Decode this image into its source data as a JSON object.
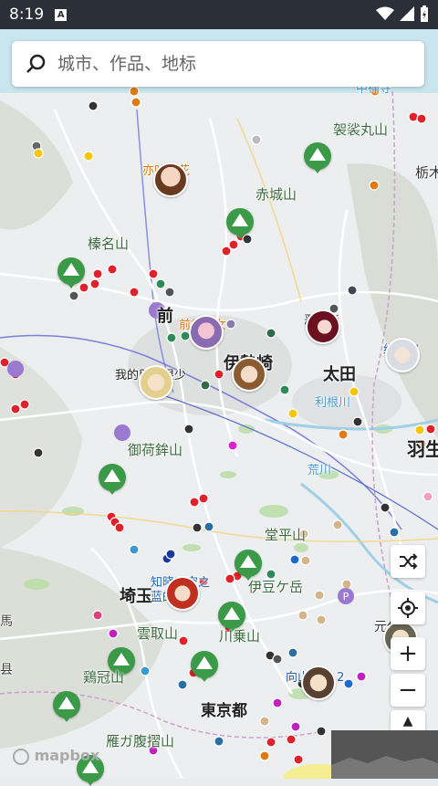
{
  "status_bar": {
    "time": "8:19",
    "notification_glyph": "A"
  },
  "search": {
    "placeholder": "城市、作品、地标"
  },
  "mountains": [
    {
      "name": "袈裟丸山"
    },
    {
      "name": "赤城山"
    },
    {
      "name": "榛名山"
    },
    {
      "name": "御荷鉾山"
    },
    {
      "name": "堂平山"
    },
    {
      "name": "伊豆ケ岳"
    },
    {
      "name": "雲取山"
    },
    {
      "name": "川乗山"
    },
    {
      "name": "鶏冠山"
    },
    {
      "name": "雁ガ腹摺山"
    }
  ],
  "cities": [
    {
      "name": "前"
    },
    {
      "name": "伊勢崎"
    },
    {
      "name": "太田"
    },
    {
      "name": "羽生"
    },
    {
      "name": "荒川"
    },
    {
      "name": "利根川"
    },
    {
      "name": "埼玉"
    },
    {
      "name": "東京都"
    },
    {
      "name": "中禅寺"
    },
    {
      "name": "栃木"
    },
    {
      "name": "元代"
    },
    {
      "name": "县"
    },
    {
      "name": "馬"
    }
  ],
  "works": [
    {
      "name": "亦叶亦花"
    },
    {
      "name": "前桥魔女"
    },
    {
      "name": "恶之华"
    },
    {
      "name": "缘之空"
    },
    {
      "name": "我的朋友很少"
    },
    {
      "name": "知晓天空之蓝的人啊"
    },
    {
      "name": "向山进发 2"
    }
  ],
  "controls": {
    "zoom_in": "+",
    "zoom_out": "−",
    "compass": "▲"
  },
  "attribution": "mapbox",
  "colors": {
    "pin_green": "#3a9a48",
    "marker_red": "#e0202a",
    "road": "#ffffff",
    "water": "#9fd0e8"
  }
}
